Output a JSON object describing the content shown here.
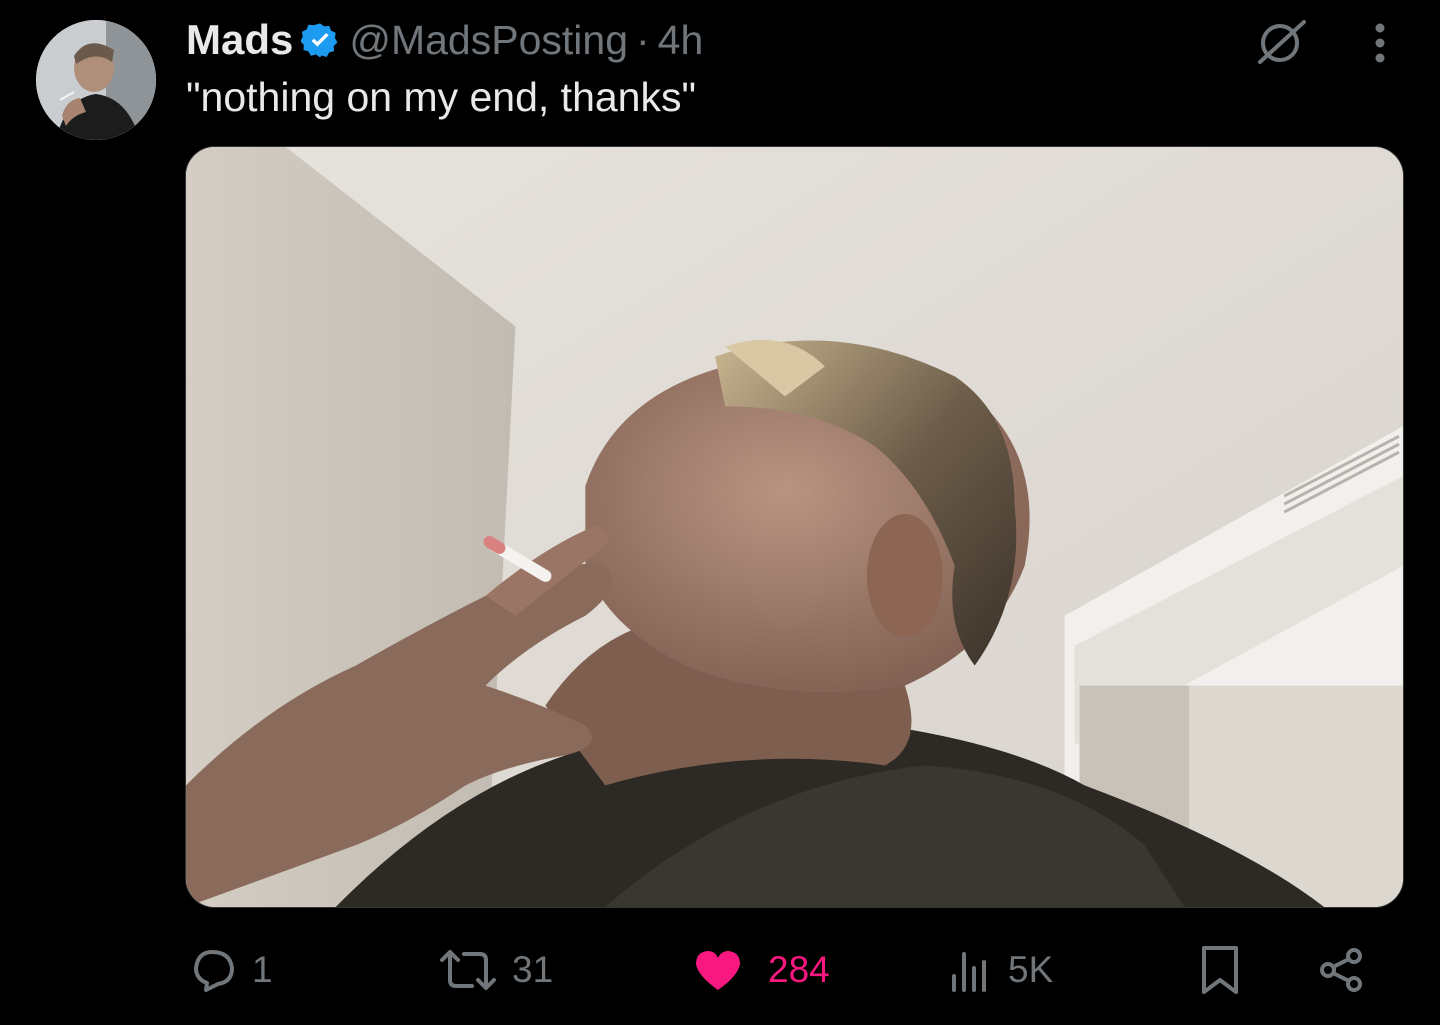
{
  "author": {
    "name": "Mads",
    "handle": "@MadsPosting",
    "separator": "·",
    "time": "4h",
    "verified": true,
    "verified_color": "#1d9bf0"
  },
  "tweet": {
    "text": "\"nothing on my end, thanks\""
  },
  "media": {
    "kind": "photo",
    "description_icon": "photo-media"
  },
  "actions": {
    "reply": {
      "icon": "reply-icon",
      "count": "1"
    },
    "retweet": {
      "icon": "retweet-icon",
      "count": "31"
    },
    "like": {
      "icon": "heart-icon",
      "count": "284",
      "liked": true,
      "color": "#f91880"
    },
    "views": {
      "icon": "views-icon",
      "count": "5K"
    },
    "bookmark": {
      "icon": "bookmark-icon"
    },
    "share": {
      "icon": "share-icon"
    }
  },
  "header_icons": {
    "grok": "grok-icon",
    "more": "more-icon"
  },
  "colors": {
    "background": "#000000",
    "text_primary": "#e7e9ea",
    "text_secondary": "#71767b"
  }
}
